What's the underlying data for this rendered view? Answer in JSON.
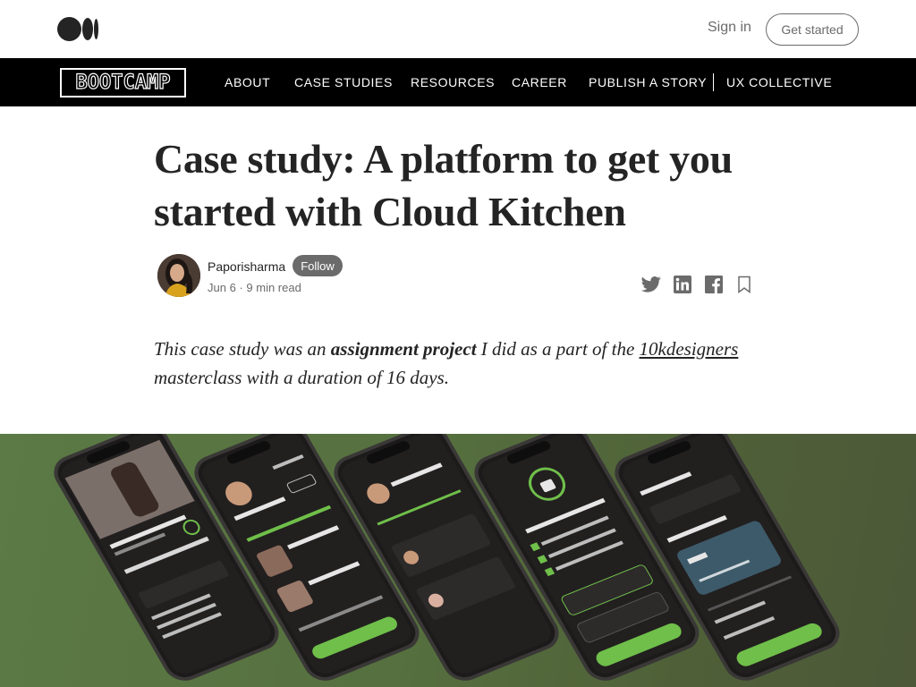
{
  "topbar": {
    "sign_in": "Sign in",
    "get_started": "Get started"
  },
  "publication": {
    "brand": "BOOTCAMP",
    "nav": [
      "ABOUT",
      "CASE STUDIES",
      "RESOURCES",
      "CAREER",
      "PUBLISH A STORY",
      "UX COLLECTIVE"
    ]
  },
  "article": {
    "title_line1": "Case study: A platform to get you",
    "title_line2": "started with Cloud Kitchen",
    "author": "Paporisharma",
    "follow_label": "Follow",
    "date": "Jun 6",
    "separator": "·",
    "read_time": "9 min read",
    "intro_part1": "This case study was an ",
    "intro_bold": "assignment project",
    "intro_part2": " I did as a part of the ",
    "intro_link": "10kdesigners",
    "intro_part3": " masterclass with a duration of 16 days."
  },
  "colors": {
    "nav_bg": "#000000",
    "hero_green": "#56703f",
    "phone_accent": "#6fbf4a"
  },
  "icons": {
    "share": [
      "twitter-icon",
      "linkedin-icon",
      "facebook-icon",
      "bookmark-icon"
    ]
  }
}
